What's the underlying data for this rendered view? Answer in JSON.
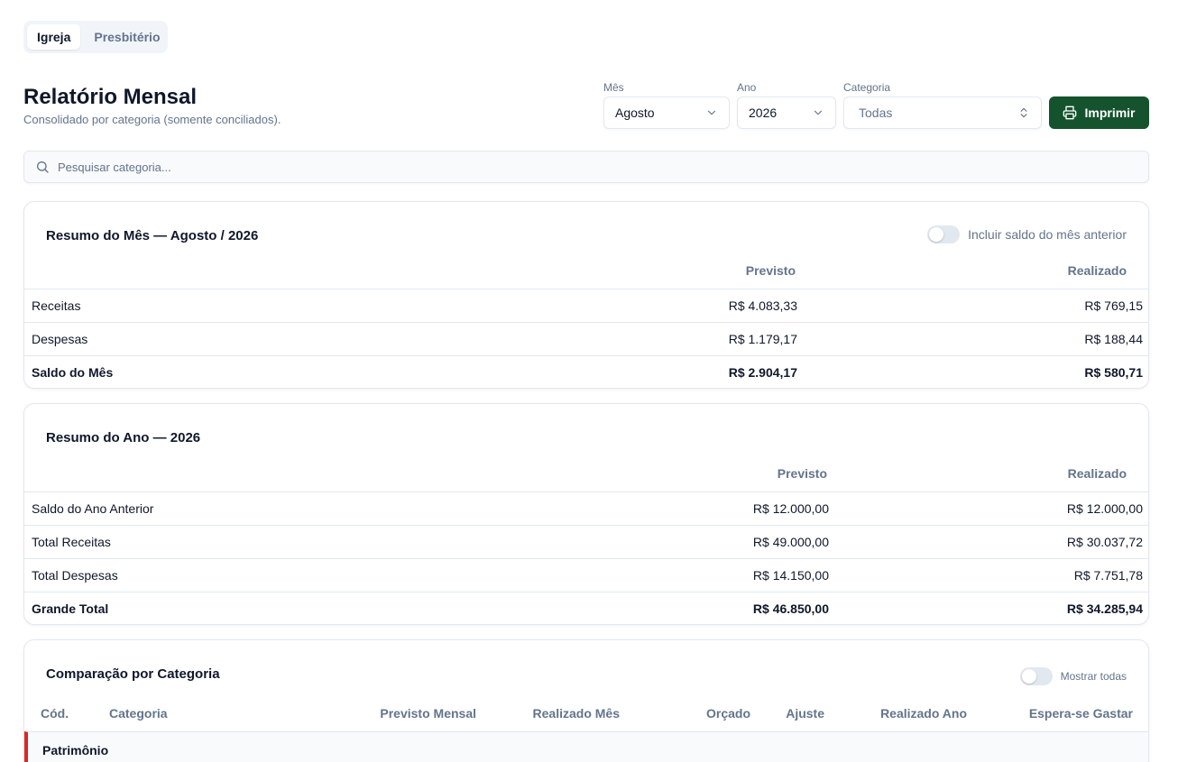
{
  "tabs": [
    {
      "label": "Igreja",
      "active": true
    },
    {
      "label": "Presbitério",
      "active": false
    }
  ],
  "header": {
    "title": "Relatório Mensal",
    "subtitle": "Consolidado por categoria (somente conciliados)."
  },
  "filters": {
    "month": {
      "label": "Mês",
      "value": "Agosto"
    },
    "year": {
      "label": "Ano",
      "value": "2026"
    },
    "category": {
      "label": "Categoria",
      "value": "Todas"
    }
  },
  "print_button": {
    "label": "Imprimir"
  },
  "search": {
    "placeholder": "Pesquisar categoria..."
  },
  "month_summary": {
    "title": "Resumo do Mês — Agosto / 2026",
    "toggle_label": "Incluir saldo do mês anterior",
    "columns": [
      "Previsto",
      "Realizado"
    ],
    "rows": [
      {
        "label": "Receitas",
        "previsto": "R$ 4.083,33",
        "realizado": "R$ 769,15"
      },
      {
        "label": "Despesas",
        "previsto": "R$ 1.179,17",
        "realizado": "R$ 188,44"
      },
      {
        "label": "Saldo do Mês",
        "previsto": "R$ 2.904,17",
        "realizado": "R$ 580,71"
      }
    ]
  },
  "year_summary": {
    "title": "Resumo do Ano — 2026",
    "columns": [
      "Previsto",
      "Realizado"
    ],
    "rows": [
      {
        "label": "Saldo do Ano Anterior",
        "previsto": "R$ 12.000,00",
        "realizado": "R$ 12.000,00"
      },
      {
        "label": "Total Receitas",
        "previsto": "R$ 49.000,00",
        "realizado": "R$ 30.037,72"
      },
      {
        "label": "Total Despesas",
        "previsto": "R$ 14.150,00",
        "realizado": "R$ 7.751,78"
      },
      {
        "label": "Grande Total",
        "previsto": "R$ 46.850,00",
        "realizado": "R$ 34.285,94"
      }
    ]
  },
  "category_comparison": {
    "title": "Comparação por Categoria",
    "toggle_label": "Mostrar todas",
    "columns": [
      "Cód.",
      "Categoria",
      "Previsto Mensal",
      "Realizado Mês",
      "Orçado",
      "Ajuste",
      "Realizado Ano",
      "Espera-se Gastar"
    ],
    "groups": [
      {
        "label": "Patrimônio"
      }
    ]
  },
  "colors": {
    "primary": "#14532d",
    "group_accent": "#dc2626",
    "muted_text": "#64748b",
    "border": "#e2e8f0"
  }
}
